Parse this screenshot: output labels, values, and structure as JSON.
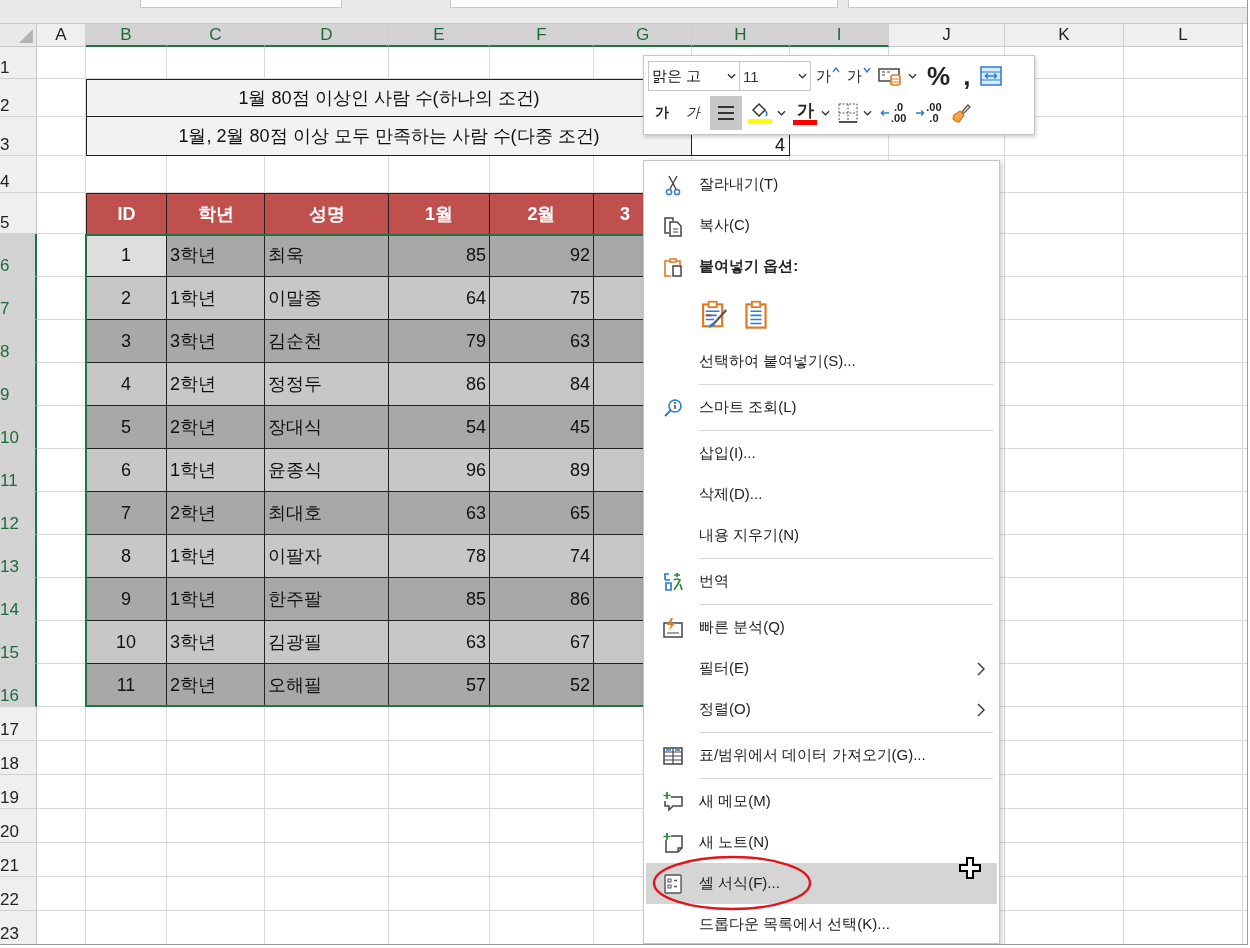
{
  "column_headers": [
    {
      "label": "A",
      "selected": false
    },
    {
      "label": "B",
      "selected": true
    },
    {
      "label": "C",
      "selected": true
    },
    {
      "label": "D",
      "selected": true
    },
    {
      "label": "E",
      "selected": true
    },
    {
      "label": "F",
      "selected": true
    },
    {
      "label": "G",
      "selected": true
    },
    {
      "label": "H",
      "selected": true
    },
    {
      "label": "I",
      "selected": true
    },
    {
      "label": "J",
      "selected": false
    },
    {
      "label": "K",
      "selected": false
    },
    {
      "label": "L",
      "selected": false
    }
  ],
  "row_headers": [
    {
      "label": "1",
      "selected": false
    },
    {
      "label": "2",
      "selected": false
    },
    {
      "label": "3",
      "selected": false
    },
    {
      "label": "4",
      "selected": false
    },
    {
      "label": "5",
      "selected": false
    },
    {
      "label": "6",
      "selected": true
    },
    {
      "label": "7",
      "selected": true
    },
    {
      "label": "8",
      "selected": true
    },
    {
      "label": "9",
      "selected": true
    },
    {
      "label": "10",
      "selected": true
    },
    {
      "label": "11",
      "selected": true
    },
    {
      "label": "12",
      "selected": true
    },
    {
      "label": "13",
      "selected": true
    },
    {
      "label": "14",
      "selected": true
    },
    {
      "label": "15",
      "selected": true
    },
    {
      "label": "16",
      "selected": true
    },
    {
      "label": "17",
      "selected": false
    },
    {
      "label": "18",
      "selected": false
    },
    {
      "label": "19",
      "selected": false
    },
    {
      "label": "20",
      "selected": false
    },
    {
      "label": "21",
      "selected": false
    },
    {
      "label": "22",
      "selected": false
    },
    {
      "label": "23",
      "selected": false
    }
  ],
  "summary": [
    {
      "label": "1월 80점 이상인 사람 수(하나의 조건)"
    },
    {
      "label": "1월, 2월 80점 이상 모두 만족하는 사람 수(다중 조건)",
      "value": "4"
    }
  ],
  "table": {
    "columns": [
      "ID",
      "학년",
      "성명",
      "1월",
      "2월",
      "3"
    ],
    "rows": [
      {
        "id": "1",
        "grade": "3학년",
        "name": "최욱",
        "jan": "85",
        "feb": "92",
        "active": true
      },
      {
        "id": "2",
        "grade": "1학년",
        "name": "이말종",
        "jan": "64",
        "feb": "75",
        "active": false
      },
      {
        "id": "3",
        "grade": "3학년",
        "name": "김순천",
        "jan": "79",
        "feb": "63",
        "active": false
      },
      {
        "id": "4",
        "grade": "2학년",
        "name": "정정두",
        "jan": "86",
        "feb": "84",
        "active": false
      },
      {
        "id": "5",
        "grade": "2학년",
        "name": "장대식",
        "jan": "54",
        "feb": "45",
        "active": false
      },
      {
        "id": "6",
        "grade": "1학년",
        "name": "윤종식",
        "jan": "96",
        "feb": "89",
        "active": false
      },
      {
        "id": "7",
        "grade": "2학년",
        "name": "최대호",
        "jan": "63",
        "feb": "65",
        "active": false
      },
      {
        "id": "8",
        "grade": "1학년",
        "name": "이팔자",
        "jan": "78",
        "feb": "74",
        "active": false
      },
      {
        "id": "9",
        "grade": "1학년",
        "name": "한주팔",
        "jan": "85",
        "feb": "86",
        "active": false
      },
      {
        "id": "10",
        "grade": "3학년",
        "name": "김광필",
        "jan": "63",
        "feb": "67",
        "active": false
      },
      {
        "id": "11",
        "grade": "2학년",
        "name": "오해필",
        "jan": "57",
        "feb": "52",
        "active": false
      }
    ]
  },
  "mini_toolbar": {
    "font": {
      "value": "맑은 고"
    },
    "size": {
      "value": "11"
    },
    "row_1": [
      {
        "kind": "grow",
        "label": "가"
      },
      {
        "kind": "shrink",
        "label": "가"
      },
      {
        "kind": "styles"
      },
      {
        "kind": "text",
        "label": "%"
      },
      {
        "kind": "text",
        "label": ","
      },
      {
        "kind": "wrap"
      }
    ],
    "row_2": [
      {
        "kind": "bold",
        "label": "가",
        "selected": false
      },
      {
        "kind": "italic",
        "label": "가",
        "selected": false
      },
      {
        "kind": "align",
        "selected": true
      },
      {
        "kind": "fill",
        "color": "#ffff00"
      },
      {
        "kind": "font_color",
        "label": "가",
        "color": "#ff0000"
      },
      {
        "kind": "borders"
      },
      {
        "kind": "decimal_less",
        "top": ".0",
        "bottom": ".00"
      },
      {
        "kind": "decimal_more",
        "top": ".00",
        "bottom": ".0"
      },
      {
        "kind": "painter"
      }
    ]
  },
  "context_menu": {
    "items": [
      {
        "kind": "cut",
        "label": "잘라내기(T)",
        "selected": false,
        "submenu": false,
        "circled": false
      },
      {
        "kind": "copy",
        "label": "복사(C)",
        "selected": false,
        "submenu": false,
        "circled": false
      },
      {
        "kind": "paste_heading",
        "label": "붙여넣기 옵션:"
      },
      {
        "kind": "paste_options",
        "options": [
          {
            "kind": "formatting"
          },
          {
            "kind": "values"
          }
        ]
      },
      {
        "kind": "plain",
        "label": "선택하여 붙여넣기(S)...",
        "selected": false,
        "submenu": false,
        "circled": false
      },
      {
        "kind": "separator"
      },
      {
        "kind": "lookup",
        "label": "스마트 조회(L)",
        "selected": false,
        "submenu": false,
        "circled": false
      },
      {
        "kind": "separator"
      },
      {
        "kind": "plain",
        "label": "삽입(I)...",
        "selected": false,
        "submenu": false,
        "circled": false
      },
      {
        "kind": "plain",
        "label": "삭제(D)...",
        "selected": false,
        "submenu": false,
        "circled": false
      },
      {
        "kind": "plain",
        "label": "내용 지우기(N)",
        "selected": false,
        "submenu": false,
        "circled": false
      },
      {
        "kind": "separator"
      },
      {
        "kind": "translate",
        "label": "번역",
        "selected": false,
        "submenu": false,
        "circled": false
      },
      {
        "kind": "separator"
      },
      {
        "kind": "quick_analysis",
        "label": "빠른 분석(Q)",
        "selected": false,
        "submenu": false,
        "circled": false
      },
      {
        "kind": "plain",
        "label": "필터(E)",
        "selected": false,
        "submenu": true,
        "circled": false
      },
      {
        "kind": "plain",
        "label": "정렬(O)",
        "selected": false,
        "submenu": true,
        "circled": false
      },
      {
        "kind": "separator"
      },
      {
        "kind": "table",
        "label": "표/범위에서 데이터 가져오기(G)...",
        "selected": false,
        "submenu": false,
        "circled": false
      },
      {
        "kind": "separator"
      },
      {
        "kind": "comment",
        "label": "새 메모(M)",
        "selected": false,
        "submenu": false,
        "circled": false
      },
      {
        "kind": "note",
        "label": "새 노트(N)",
        "selected": false,
        "submenu": false,
        "circled": false
      },
      {
        "kind": "format",
        "label": "셀 서식(F)...",
        "selected": true,
        "submenu": false,
        "circled": true
      },
      {
        "kind": "plain",
        "label": "드롭다운 목록에서 선택(K)...",
        "selected": false,
        "submenu": false,
        "circled": false
      }
    ]
  }
}
